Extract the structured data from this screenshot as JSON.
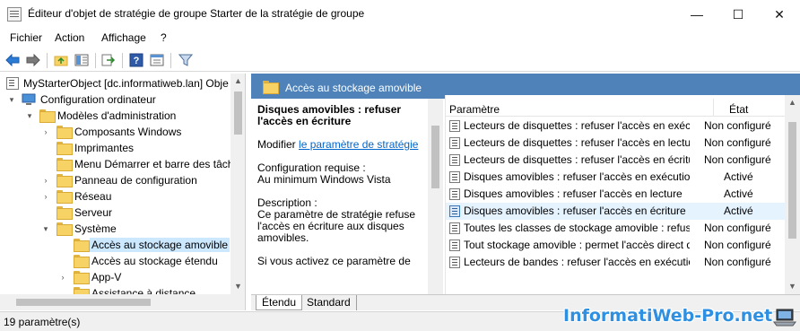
{
  "window": {
    "title": "Éditeur d'objet de stratégie de groupe Starter de la stratégie de groupe",
    "minimize": "—",
    "maximize": "☐",
    "close": "✕"
  },
  "menu": {
    "items": [
      "Fichier",
      "Action",
      "Affichage",
      "?"
    ]
  },
  "toolbar": {
    "icons": [
      "back-arrow-icon",
      "forward-arrow-icon",
      "folder-up-icon",
      "show-tree-icon",
      "export-list-icon",
      "help-icon",
      "properties-icon",
      "filter-icon"
    ]
  },
  "tree": {
    "root": "MyStarterObject [dc.informatiweb.lan] Obje",
    "items": [
      {
        "label": "Configuration ordinateur",
        "expander": "▾"
      },
      {
        "label": "Modèles d'administration",
        "expander": "▾"
      },
      {
        "label": "Composants Windows",
        "expander": "›"
      },
      {
        "label": "Imprimantes",
        "expander": ""
      },
      {
        "label": "Menu Démarrer et barre des tâch",
        "expander": ""
      },
      {
        "label": "Panneau de configuration",
        "expander": "›"
      },
      {
        "label": "Réseau",
        "expander": "›"
      },
      {
        "label": "Serveur",
        "expander": ""
      },
      {
        "label": "Système",
        "expander": "▾"
      },
      {
        "label": "Accès au stockage amovible",
        "expander": ""
      },
      {
        "label": "Accès au stockage étendu",
        "expander": ""
      },
      {
        "label": "App-V",
        "expander": "›"
      },
      {
        "label": "Assistance à distance",
        "expander": ""
      }
    ]
  },
  "header": {
    "title": "Accès au stockage amovible"
  },
  "description": {
    "policy_title": "Disques amovibles : refuser l'accès en écriture",
    "edit_prefix": "Modifier",
    "edit_link": "le paramètre de stratégie",
    "requirements": "Configuration requise :\nAu minimum Windows Vista",
    "description": "Description :\nCe paramètre de stratégie refuse l'accès en écriture aux disques amovibles.",
    "more": "Si vous activez ce paramètre de"
  },
  "list": {
    "columns": [
      "Paramètre",
      "État"
    ],
    "rows": [
      {
        "name": "Lecteurs de disquettes : refuser l'accès en exécution",
        "state": "Non configuré",
        "active": false
      },
      {
        "name": "Lecteurs de disquettes : refuser l'accès en lecture",
        "state": "Non configuré",
        "active": false
      },
      {
        "name": "Lecteurs de disquettes : refuser l'accès en écriture",
        "state": "Non configuré",
        "active": false
      },
      {
        "name": "Disques amovibles : refuser l'accès en exécution",
        "state": "Activé",
        "active": false
      },
      {
        "name": "Disques amovibles : refuser l'accès en lecture",
        "state": "Activé",
        "active": false
      },
      {
        "name": "Disques amovibles : refuser l'accès en écriture",
        "state": "Activé",
        "active": true
      },
      {
        "name": "Toutes les classes de stockage amovible : refuser tout accès",
        "state": "Non configuré",
        "active": false
      },
      {
        "name": "Tout stockage amovible : permet l'accès direct dans les sessions à distance",
        "state": "Non configuré",
        "active": false
      },
      {
        "name": "Lecteurs de bandes : refuser l'accès en exécution",
        "state": "Non configuré",
        "active": false
      }
    ]
  },
  "tabs": [
    "Étendu",
    "Standard"
  ],
  "status": {
    "text": "19 paramètre(s)"
  },
  "watermark": {
    "text": "InformatiWeb-Pro.net"
  },
  "colors": {
    "header_bg": "#4e82b9",
    "selection_bg": "#cce8ff",
    "link": "#0066cc",
    "watermark": "#2f8fe0"
  }
}
